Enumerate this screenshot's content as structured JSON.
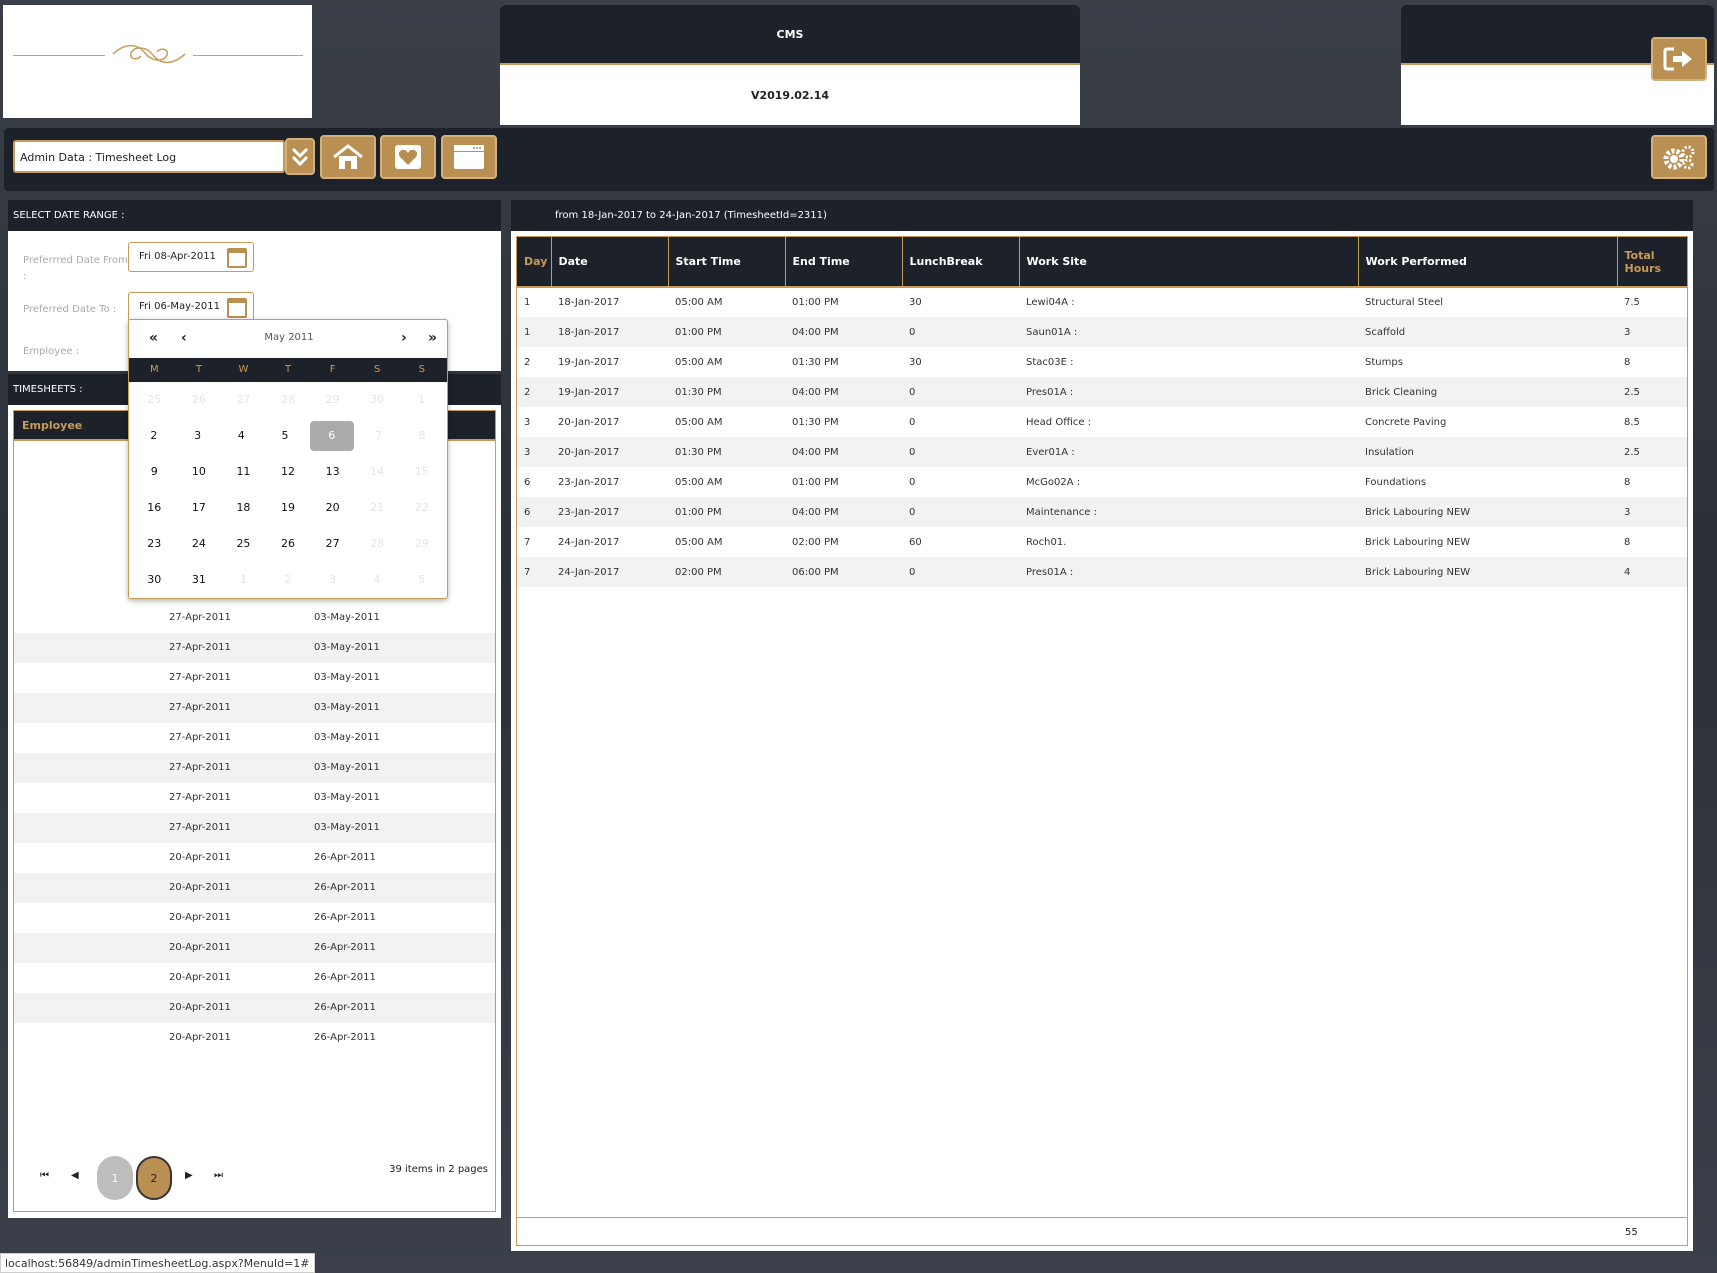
{
  "header": {
    "app_title": "CMS",
    "version": "V2019.02.14"
  },
  "toolbar": {
    "menu_selected": "Admin Data : Timesheet Log"
  },
  "date_range": {
    "title": "SELECT DATE RANGE :",
    "from_label": "Preferrred Date From",
    "from_value": "Fri 08-Apr-2011",
    "to_label": "Preferred Date To :",
    "to_value": "Fri 06-May-2011",
    "employee_label": "Employee :"
  },
  "calendar": {
    "title": "May 2011",
    "nav": [
      "«",
      "‹",
      "›",
      "»"
    ],
    "dow": [
      "M",
      "T",
      "W",
      "T",
      "F",
      "S",
      "S"
    ],
    "weeks": [
      [
        {
          "d": "25",
          "dim": true
        },
        {
          "d": "26",
          "dim": true
        },
        {
          "d": "27",
          "dim": true
        },
        {
          "d": "28",
          "dim": true
        },
        {
          "d": "29",
          "dim": true
        },
        {
          "d": "30",
          "dim": true
        },
        {
          "d": "1",
          "dim": true
        }
      ],
      [
        {
          "d": "2"
        },
        {
          "d": "3"
        },
        {
          "d": "4"
        },
        {
          "d": "5"
        },
        {
          "d": "6",
          "sel": true
        },
        {
          "d": "7",
          "dim": true
        },
        {
          "d": "8",
          "dim": true
        }
      ],
      [
        {
          "d": "9"
        },
        {
          "d": "10"
        },
        {
          "d": "11"
        },
        {
          "d": "12"
        },
        {
          "d": "13"
        },
        {
          "d": "14",
          "dim": true
        },
        {
          "d": "15",
          "dim": true
        }
      ],
      [
        {
          "d": "16"
        },
        {
          "d": "17"
        },
        {
          "d": "18"
        },
        {
          "d": "19"
        },
        {
          "d": "20"
        },
        {
          "d": "21",
          "dim": true
        },
        {
          "d": "22",
          "dim": true
        }
      ],
      [
        {
          "d": "23"
        },
        {
          "d": "24"
        },
        {
          "d": "25"
        },
        {
          "d": "26"
        },
        {
          "d": "27"
        },
        {
          "d": "28",
          "dim": true
        },
        {
          "d": "29",
          "dim": true
        }
      ],
      [
        {
          "d": "30"
        },
        {
          "d": "31"
        },
        {
          "d": "1",
          "dim": true
        },
        {
          "d": "2",
          "dim": true
        },
        {
          "d": "3",
          "dim": true
        },
        {
          "d": "4",
          "dim": true
        },
        {
          "d": "5",
          "dim": true
        }
      ]
    ]
  },
  "timesheets": {
    "title": "TIMESHEETS :",
    "column_employee": "Employee",
    "rows": [
      {
        "start": "27-Apr-2011",
        "end": "03-May-2011"
      },
      {
        "start": "27-Apr-2011",
        "end": "03-May-2011"
      },
      {
        "start": "27-Apr-2011",
        "end": "03-May-2011"
      },
      {
        "start": "27-Apr-2011",
        "end": "03-May-2011"
      },
      {
        "start": "27-Apr-2011",
        "end": "03-May-2011"
      },
      {
        "start": "27-Apr-2011",
        "end": "03-May-2011"
      },
      {
        "start": "27-Apr-2011",
        "end": "03-May-2011"
      },
      {
        "start": "27-Apr-2011",
        "end": "03-May-2011"
      },
      {
        "start": "20-Apr-2011",
        "end": "26-Apr-2011"
      },
      {
        "start": "20-Apr-2011",
        "end": "26-Apr-2011"
      },
      {
        "start": "20-Apr-2011",
        "end": "26-Apr-2011"
      },
      {
        "start": "20-Apr-2011",
        "end": "26-Apr-2011"
      },
      {
        "start": "20-Apr-2011",
        "end": "26-Apr-2011"
      },
      {
        "start": "20-Apr-2011",
        "end": "26-Apr-2011"
      },
      {
        "start": "20-Apr-2011",
        "end": "26-Apr-2011"
      }
    ],
    "pager": {
      "page1": "1",
      "page2": "2",
      "summary": "39 items in 2 pages",
      "first": "⏮",
      "prev": "◀",
      "next": "▶",
      "last": "⏭"
    }
  },
  "detail": {
    "title": "from 18-Jan-2017 to 24-Jan-2017 (TimesheetId=2311)",
    "columns": [
      "Day",
      "Date",
      "Start Time",
      "End Time",
      "LunchBreak",
      "Work Site",
      "Work Performed",
      "Total Hours"
    ],
    "rows": [
      [
        "1",
        "18-Jan-2017",
        "05:00 AM",
        "01:00 PM",
        "30",
        "Lewi04A :",
        "Structural Steel",
        "7.5"
      ],
      [
        "1",
        "18-Jan-2017",
        "01:00 PM",
        "04:00 PM",
        "0",
        "Saun01A :",
        "Scaffold",
        "3"
      ],
      [
        "2",
        "19-Jan-2017",
        "05:00 AM",
        "01:30 PM",
        "30",
        "Stac03E :",
        "Stumps",
        "8"
      ],
      [
        "2",
        "19-Jan-2017",
        "01:30 PM",
        "04:00 PM",
        "0",
        "Pres01A :",
        "Brick Cleaning",
        "2.5"
      ],
      [
        "3",
        "20-Jan-2017",
        "05:00 AM",
        "01:30 PM",
        "0",
        "Head Office :",
        "Concrete Paving",
        "8.5"
      ],
      [
        "3",
        "20-Jan-2017",
        "01:30 PM",
        "04:00 PM",
        "0",
        "Ever01A :",
        "Insulation",
        "2.5"
      ],
      [
        "6",
        "23-Jan-2017",
        "05:00 AM",
        "01:00 PM",
        "0",
        "McGo02A :",
        "Foundations",
        "8"
      ],
      [
        "6",
        "23-Jan-2017",
        "01:00 PM",
        "04:00 PM",
        "0",
        "Maintenance :",
        "Brick Labouring NEW",
        "3"
      ],
      [
        "7",
        "24-Jan-2017",
        "05:00 AM",
        "02:00 PM",
        "60",
        "Roch01.",
        "Brick Labouring NEW",
        "8"
      ],
      [
        "7",
        "24-Jan-2017",
        "02:00 PM",
        "06:00 PM",
        "0",
        "Pres01A :",
        "Brick Labouring NEW",
        "4"
      ]
    ],
    "total": "55"
  },
  "status_bar": "localhost:56849/adminTimesheetLog.aspx?MenuId=1#",
  "colors": {
    "accent": "#c69b57",
    "header_bg": "#1d2129"
  }
}
